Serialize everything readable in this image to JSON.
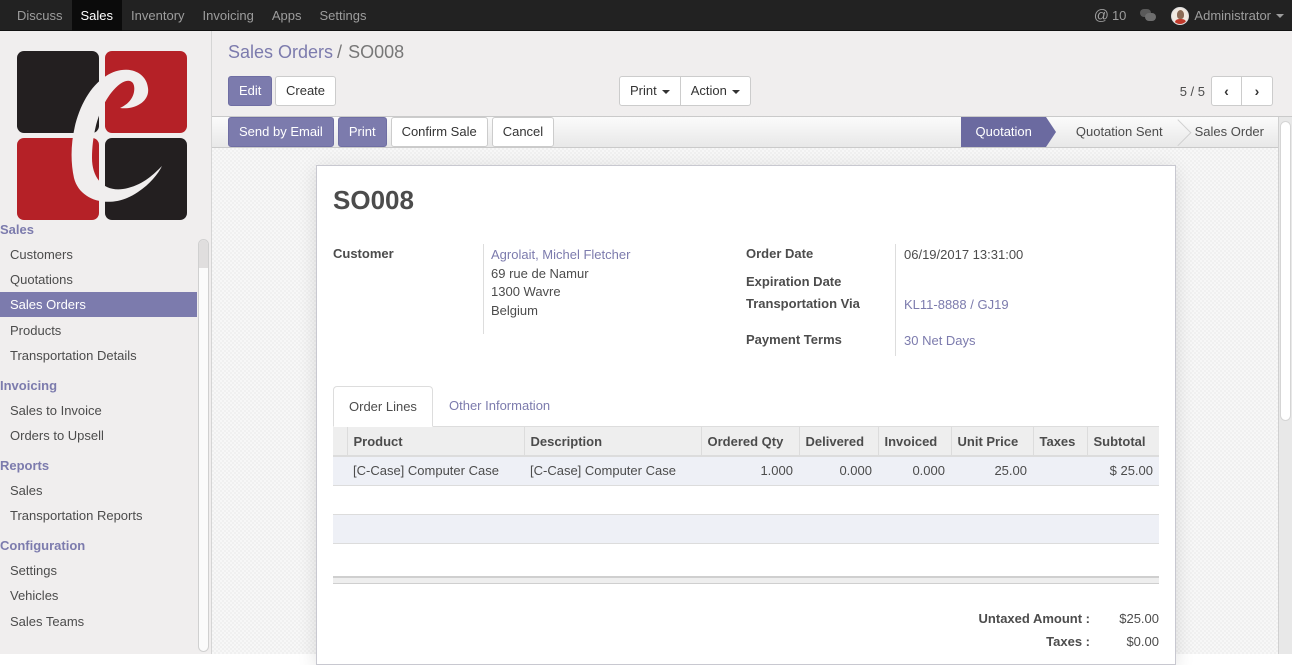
{
  "navbar": {
    "apps": [
      {
        "label": "Discuss",
        "active": false
      },
      {
        "label": "Sales",
        "active": true
      },
      {
        "label": "Inventory",
        "active": false
      },
      {
        "label": "Invoicing",
        "active": false
      },
      {
        "label": "Apps",
        "active": false
      },
      {
        "label": "Settings",
        "active": false
      }
    ],
    "mentions_icon": "@",
    "mentions_count": "10",
    "chat_icon": "chat-bubbles-icon",
    "user_name": "Administrator"
  },
  "sidebar": {
    "sections": [
      {
        "header": "Sales",
        "items": [
          {
            "label": "Customers",
            "active": false
          },
          {
            "label": "Quotations",
            "active": false
          },
          {
            "label": "Sales Orders",
            "active": true
          },
          {
            "label": "Products",
            "active": false
          },
          {
            "label": "Transportation Details",
            "active": false
          }
        ]
      },
      {
        "header": "Invoicing",
        "items": [
          {
            "label": "Sales to Invoice",
            "active": false
          },
          {
            "label": "Orders to Upsell",
            "active": false
          }
        ]
      },
      {
        "header": "Reports",
        "items": [
          {
            "label": "Sales",
            "active": false
          },
          {
            "label": "Transportation Reports",
            "active": false
          }
        ]
      },
      {
        "header": "Configuration",
        "items": [
          {
            "label": "Settings",
            "active": false
          },
          {
            "label": "Vehicles",
            "active": false
          },
          {
            "label": "Sales Teams",
            "active": false
          }
        ]
      }
    ]
  },
  "control_panel": {
    "breadcrumb_parent": "Sales Orders",
    "breadcrumb_sep": "/",
    "breadcrumb_current": "SO008",
    "edit_label": "Edit",
    "create_label": "Create",
    "print_label": "Print",
    "action_label": "Action",
    "pager_value": "5 / 5",
    "pager_prev": "‹",
    "pager_next": "›"
  },
  "statusbar": {
    "buttons": [
      "Send by Email",
      "Print",
      "Confirm Sale",
      "Cancel"
    ],
    "steps": [
      {
        "label": "Quotation",
        "active": true
      },
      {
        "label": "Quotation Sent",
        "active": false
      },
      {
        "label": "Sales Order",
        "active": false
      }
    ]
  },
  "form": {
    "name": "SO008",
    "customer_label": "Customer",
    "customer_name": "Agrolait, Michel Fletcher",
    "customer_address": [
      "69 rue de Namur",
      "1300 Wavre",
      "Belgium"
    ],
    "order_date_label": "Order Date",
    "order_date": "06/19/2017 13:31:00",
    "expiration_date_label": "Expiration Date",
    "expiration_date": "",
    "transport_label": "Transportation Via",
    "transport_value": "KL11-8888 / GJ19",
    "payment_terms_label": "Payment Terms",
    "payment_terms_value": "30 Net Days",
    "tabs": [
      "Order Lines",
      "Other Information"
    ],
    "lines": {
      "columns": [
        "Product",
        "Description",
        "Ordered Qty",
        "Delivered",
        "Invoiced",
        "Unit Price",
        "Taxes",
        "Subtotal"
      ],
      "rows": [
        {
          "product": "[C-Case] Computer Case",
          "description": "[C-Case] Computer Case",
          "ordered_qty": "1.000",
          "delivered": "0.000",
          "invoiced": "0.000",
          "unit_price": "25.00",
          "taxes": "",
          "subtotal": "$ 25.00"
        }
      ]
    },
    "totals": {
      "untaxed_label": "Untaxed Amount :",
      "untaxed_value": "$25.00",
      "taxes_label": "Taxes :",
      "taxes_value": "$0.00"
    }
  },
  "colors": {
    "brand": "#7c7bad",
    "navbar_bg": "#222222",
    "sidebar_bg": "#f0eeee",
    "logo_red": "#b52127",
    "logo_black": "#231f20"
  }
}
